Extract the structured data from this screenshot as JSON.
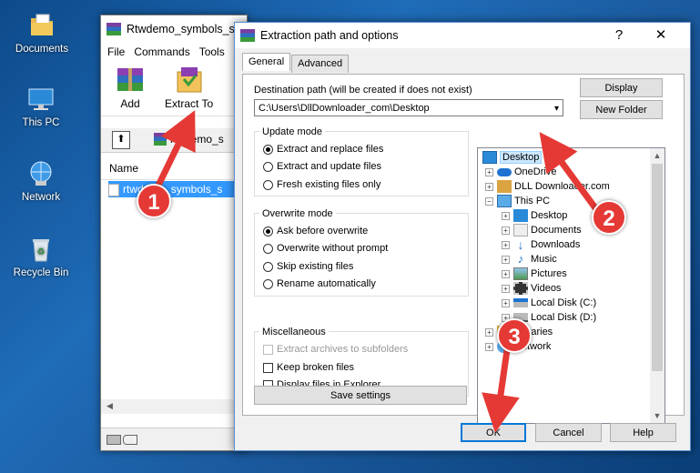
{
  "desktop": {
    "icons": [
      {
        "label": "Documents"
      },
      {
        "label": "This PC"
      },
      {
        "label": "Network"
      },
      {
        "label": "Recycle Bin"
      }
    ]
  },
  "winrar": {
    "title": "Rtwdemo_symbols_s",
    "menu": [
      "File",
      "Commands",
      "Tools"
    ],
    "toolbar": {
      "add_label": "Add",
      "extract_label": "Extract To"
    },
    "path": "rtwdemo_s",
    "column_name": "Name",
    "selected_file": "rtwdemo_symbols_s"
  },
  "dialog": {
    "title": "Extraction path and options",
    "help_glyph": "?",
    "close_glyph": "✕",
    "tabs": [
      "General",
      "Advanced"
    ],
    "destination_label": "Destination path (will be created if does not exist)",
    "destination_value": "C:\\Users\\DllDownloader_com\\Desktop",
    "display_button": "Display",
    "new_folder_button": "New Folder",
    "update_mode": {
      "title": "Update mode",
      "options": [
        "Extract and replace files",
        "Extract and update files",
        "Fresh existing files only"
      ],
      "selected": 0
    },
    "overwrite_mode": {
      "title": "Overwrite mode",
      "options": [
        "Ask before overwrite",
        "Overwrite without prompt",
        "Skip existing files",
        "Rename automatically"
      ],
      "selected": 0
    },
    "misc": {
      "title": "Miscellaneous",
      "options": [
        "Extract archives to subfolders",
        "Keep broken files",
        "Display files in Explorer"
      ],
      "disabled_index": 0
    },
    "save_settings": "Save settings",
    "tree": [
      "Desktop",
      "OneDrive",
      "DLL Downloader.com",
      "This PC",
      "Desktop",
      "Documents",
      "Downloads",
      "Music",
      "Pictures",
      "Videos",
      "Local Disk (C:)",
      "Local Disk (D:)",
      "Libraries",
      "Network"
    ],
    "ok": "OK",
    "cancel": "Cancel",
    "help": "Help"
  },
  "callouts": [
    "1",
    "2",
    "3"
  ],
  "colors": {
    "callout": "#e53935",
    "selection": "#3399ff",
    "accent": "#0078d7"
  }
}
